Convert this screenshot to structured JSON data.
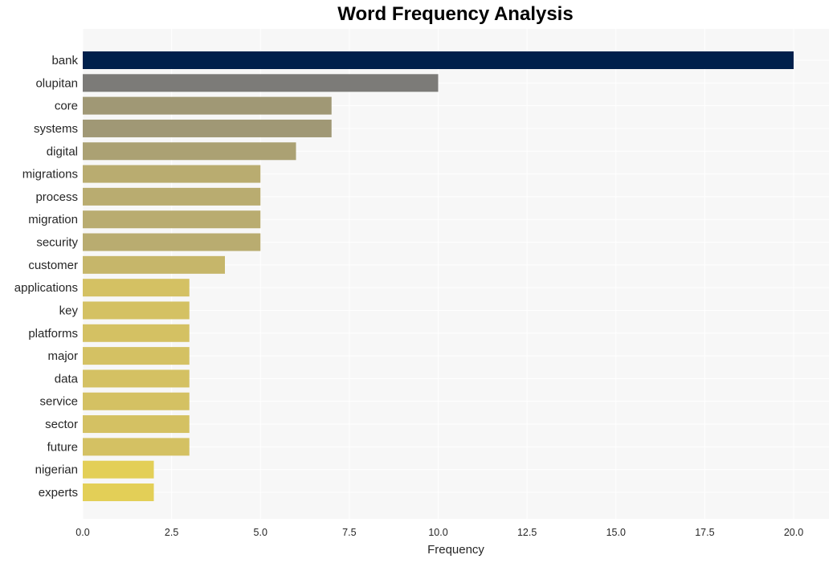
{
  "chart_data": {
    "type": "bar",
    "orientation": "horizontal",
    "title": "Word Frequency Analysis",
    "xlabel": "Frequency",
    "ylabel": "",
    "xlim": [
      0,
      21
    ],
    "xticks": [
      0.0,
      2.5,
      5.0,
      7.5,
      10.0,
      12.5,
      15.0,
      17.5,
      20.0
    ],
    "xtick_labels": [
      "0.0",
      "2.5",
      "5.0",
      "7.5",
      "10.0",
      "12.5",
      "15.0",
      "17.5",
      "20.0"
    ],
    "grid": true,
    "categories": [
      "bank",
      "olupitan",
      "core",
      "systems",
      "digital",
      "migrations",
      "process",
      "migration",
      "security",
      "customer",
      "applications",
      "key",
      "platforms",
      "major",
      "data",
      "service",
      "sector",
      "future",
      "nigerian",
      "experts"
    ],
    "values": [
      20,
      10,
      7,
      7,
      6,
      5,
      5,
      5,
      5,
      4,
      3,
      3,
      3,
      3,
      3,
      3,
      3,
      3,
      2,
      2
    ],
    "colors": [
      "#00204c",
      "#7c7b78",
      "#a09875",
      "#a09875",
      "#aba173",
      "#b9ac70",
      "#b9ac70",
      "#b9ac70",
      "#b9ac70",
      "#c6b66a",
      "#d4c163",
      "#d4c163",
      "#d4c163",
      "#d4c163",
      "#d4c163",
      "#d4c163",
      "#d4c163",
      "#d4c163",
      "#e3cf57",
      "#e3cf57"
    ],
    "background": "#f7f7f7",
    "grid_color": "#ffffff"
  }
}
